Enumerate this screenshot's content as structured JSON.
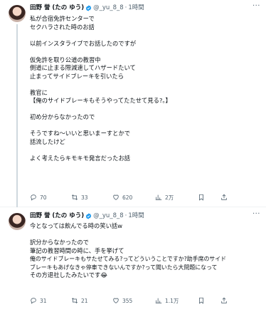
{
  "tweets": [
    {
      "name": "田野 誉 (たの ゆう)",
      "handle": "@_yu_8_8",
      "dot": "·",
      "time": "1時間",
      "lines": [
        "私が合宿免許センターで",
        "セクハラされた時のお話",
        "",
        "以前インスタライブでお話したのですが",
        "",
        "仮免許を取り公道の教習中",
        "側道に止まる際減速してハザードたいて",
        "止まってサイドブレーキを引いたら",
        "",
        "教官に",
        "【俺のサイドブレーキもそうやってたたせて見る?。】",
        "",
        "初め分からなかったので",
        "",
        "そうですね〜いいと思いまーすとかで",
        "話流したけど",
        "",
        "よく考えたらキモキモ発言だったお話"
      ],
      "replies": "70",
      "retweets": "33",
      "likes": "620",
      "views": "2万"
    },
    {
      "name": "田野 誉 (たの ゆう)",
      "handle": "@_yu_8_8",
      "dot": "·",
      "time": "1時間",
      "lines": [
        "今となっては飲んでる時の笑い話w",
        "",
        "訳分からなかったので",
        "筆記の教習時間の時に、手を挙げて",
        "俺のサイドブレーキもサたせてみる?ってどういうことですか?助手席のサイド",
        "ブレーキもあげなきゃ停車できないんですか?って聞いたら大問題になって",
        "その方退社したみたいです😂"
      ],
      "replies": "31",
      "retweets": "21",
      "likes": "355",
      "views": "1.1万"
    }
  ],
  "more_label": "···",
  "colors": {
    "verified": "#1d9bf0",
    "meta": "#536471",
    "text": "#0f1419"
  }
}
